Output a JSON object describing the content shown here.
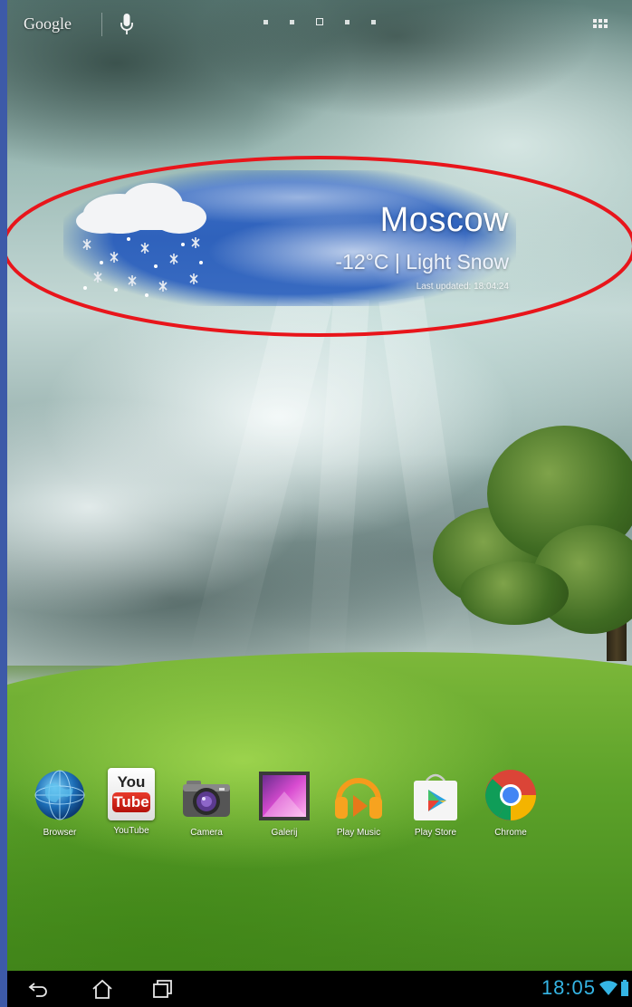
{
  "topbar": {
    "search_label": "Google",
    "icons": {
      "voice": "mic-icon",
      "apps": "apps-grid-icon"
    },
    "pages": {
      "count": 5,
      "current": 3
    }
  },
  "weather": {
    "city": "Moscow",
    "condition": "-12°C | Light Snow",
    "last_updated": "Last updated: 18:04:24",
    "icon": "snow-cloud-icon"
  },
  "dock": {
    "items": [
      {
        "label": "Browser",
        "icon": "browser-globe-icon"
      },
      {
        "label": "YouTube",
        "icon": "youtube-icon",
        "logo_text_top": "You",
        "logo_text_bottom": "Tube"
      },
      {
        "label": "Camera",
        "icon": "camera-icon"
      },
      {
        "label": "Galerij",
        "icon": "gallery-icon"
      },
      {
        "label": "Play Music",
        "icon": "play-music-icon"
      },
      {
        "label": "Play Store",
        "icon": "play-store-icon"
      },
      {
        "label": "Chrome",
        "icon": "chrome-icon"
      }
    ]
  },
  "navbar": {
    "clock": "18:05",
    "icons": {
      "back": "back-icon",
      "home": "home-icon",
      "recents": "recent-apps-icon",
      "wifi": "wifi-icon",
      "battery": "battery-icon"
    }
  },
  "colors": {
    "frame": "#3d5aa8",
    "clock": "#35b5e5",
    "highlight": "#e8151b",
    "widget_sky": "#2f62bc"
  }
}
